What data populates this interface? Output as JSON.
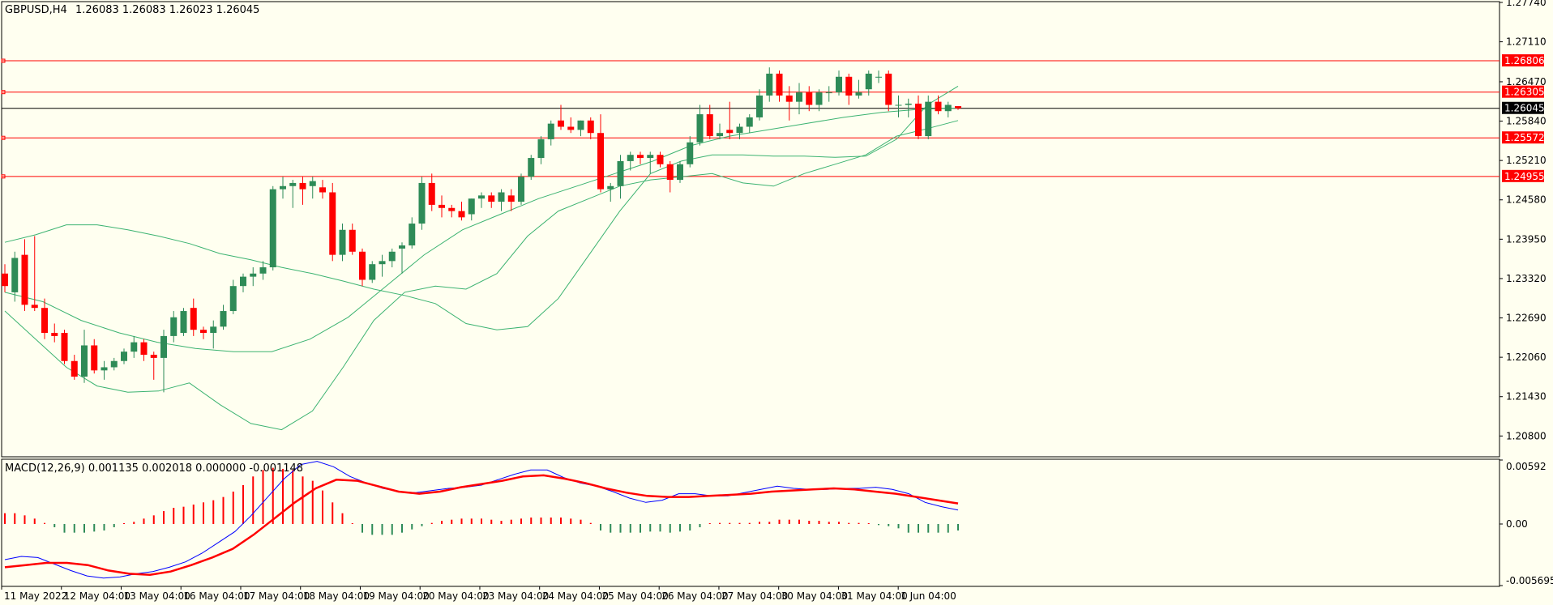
{
  "header": {
    "symbol": "GBPUSD,H4",
    "ohlc": "1.26083 1.26083 1.26023 1.26045"
  },
  "macd": {
    "label": "MACD(12,26,9) 0.001135 0.002018 0.000000 -0.001148"
  },
  "colors": {
    "background": "#fffff0",
    "bull_candle": "#2e8b57",
    "bear_candle": "#ff0000",
    "bands": "#3cb371",
    "hline": "#ff0000",
    "price_tag": "#ff0000",
    "current_price_tag": "#000000",
    "macd_line": "#0000ff",
    "signal_line": "#ff0000"
  },
  "chart_data": [
    {
      "type": "candlestick",
      "name": "GBPUSD H4",
      "ylim": [
        1.2048,
        1.2774
      ],
      "y_ticks": [
        "1.27740",
        "1.27110",
        "1.26470",
        "1.25840",
        "1.25210",
        "1.24580",
        "1.23950",
        "1.23320",
        "1.22690",
        "1.22060",
        "1.21430",
        "1.20800"
      ],
      "x_ticks": [
        "11 May 2022",
        "12 May 04:00",
        "13 May 04:00",
        "16 May 04:00",
        "17 May 04:00",
        "18 May 04:00",
        "19 May 04:00",
        "20 May 04:00",
        "23 May 04:00",
        "24 May 04:00",
        "25 May 04:00",
        "26 May 04:00",
        "27 May 04:00",
        "30 May 04:00",
        "31 May 04:00",
        "1 Jun 04:00"
      ],
      "horizontal_levels": [
        "1.26806",
        "1.26305",
        "1.25572",
        "1.24955"
      ],
      "current_price": "1.26045",
      "candles": [
        [
          1.234,
          1.2355,
          1.231,
          1.232
        ],
        [
          1.231,
          1.2375,
          1.2295,
          1.2365
        ],
        [
          1.237,
          1.2395,
          1.228,
          1.229
        ],
        [
          1.229,
          1.24,
          1.228,
          1.2285
        ],
        [
          1.2285,
          1.23,
          1.2235,
          1.2245
        ],
        [
          1.2245,
          1.226,
          1.223,
          1.224
        ],
        [
          1.2245,
          1.225,
          1.2195,
          1.22
        ],
        [
          1.22,
          1.221,
          1.217,
          1.2175
        ],
        [
          1.2175,
          1.225,
          1.2165,
          1.2225
        ],
        [
          1.2225,
          1.2235,
          1.218,
          1.2185
        ],
        [
          1.2185,
          1.22,
          1.217,
          1.219
        ],
        [
          1.219,
          1.2205,
          1.2185,
          1.22
        ],
        [
          1.22,
          1.222,
          1.2195,
          1.2215
        ],
        [
          1.2215,
          1.224,
          1.2205,
          1.223
        ],
        [
          1.223,
          1.2235,
          1.22,
          1.221
        ],
        [
          1.221,
          1.2215,
          1.217,
          1.2205
        ],
        [
          1.2205,
          1.225,
          1.215,
          1.224
        ],
        [
          1.224,
          1.228,
          1.223,
          1.227
        ],
        [
          1.2245,
          1.2285,
          1.224,
          1.228
        ],
        [
          1.2285,
          1.23,
          1.224,
          1.225
        ],
        [
          1.225,
          1.2255,
          1.2235,
          1.2245
        ],
        [
          1.2245,
          1.2265,
          1.222,
          1.2255
        ],
        [
          1.2255,
          1.229,
          1.225,
          1.228
        ],
        [
          1.228,
          1.233,
          1.2275,
          1.232
        ],
        [
          1.232,
          1.234,
          1.231,
          1.2335
        ],
        [
          1.2335,
          1.235,
          1.232,
          1.234
        ],
        [
          1.234,
          1.236,
          1.233,
          1.235
        ],
        [
          1.235,
          1.248,
          1.2345,
          1.2475
        ],
        [
          1.2475,
          1.2495,
          1.246,
          1.248
        ],
        [
          1.248,
          1.249,
          1.2445,
          1.2485
        ],
        [
          1.2485,
          1.2495,
          1.245,
          1.2475
        ],
        [
          1.248,
          1.2495,
          1.246,
          1.2488
        ],
        [
          1.2478,
          1.249,
          1.246,
          1.247
        ],
        [
          1.247,
          1.2485,
          1.236,
          1.237
        ],
        [
          1.237,
          1.242,
          1.236,
          1.241
        ],
        [
          1.241,
          1.242,
          1.237,
          1.2375
        ],
        [
          1.2375,
          1.238,
          1.232,
          1.233
        ],
        [
          1.233,
          1.236,
          1.2325,
          1.2355
        ],
        [
          1.2355,
          1.237,
          1.2335,
          1.236
        ],
        [
          1.236,
          1.238,
          1.235,
          1.2375
        ],
        [
          1.238,
          1.239,
          1.234,
          1.2385
        ],
        [
          1.2385,
          1.243,
          1.238,
          1.242
        ],
        [
          1.242,
          1.2495,
          1.241,
          1.2485
        ],
        [
          1.2485,
          1.25,
          1.244,
          1.245
        ],
        [
          1.245,
          1.2465,
          1.243,
          1.2445
        ],
        [
          1.2445,
          1.245,
          1.243,
          1.244
        ],
        [
          1.244,
          1.2455,
          1.2425,
          1.243
        ],
        [
          1.2435,
          1.246,
          1.2425,
          1.246
        ],
        [
          1.246,
          1.247,
          1.2445,
          1.2465
        ],
        [
          1.2465,
          1.247,
          1.2445,
          1.2455
        ],
        [
          1.2455,
          1.2475,
          1.244,
          1.247
        ],
        [
          1.2465,
          1.2475,
          1.244,
          1.2455
        ],
        [
          1.2455,
          1.25,
          1.245,
          1.2495
        ],
        [
          1.2495,
          1.253,
          1.249,
          1.2525
        ],
        [
          1.2525,
          1.256,
          1.2515,
          1.2555
        ],
        [
          1.2555,
          1.2585,
          1.2545,
          1.258
        ],
        [
          1.2585,
          1.261,
          1.257,
          1.2575
        ],
        [
          1.2575,
          1.259,
          1.2565,
          1.257
        ],
        [
          1.257,
          1.2585,
          1.256,
          1.2585
        ],
        [
          1.2585,
          1.259,
          1.2555,
          1.2565
        ],
        [
          1.2565,
          1.2595,
          1.247,
          1.2475
        ],
        [
          1.2475,
          1.2485,
          1.2455,
          1.248
        ],
        [
          1.248,
          1.253,
          1.246,
          1.252
        ],
        [
          1.252,
          1.2535,
          1.2505,
          1.253
        ],
        [
          1.253,
          1.2535,
          1.2515,
          1.2525
        ],
        [
          1.2525,
          1.2535,
          1.25,
          1.253
        ],
        [
          1.253,
          1.2535,
          1.251,
          1.2515
        ],
        [
          1.2515,
          1.252,
          1.247,
          1.249
        ],
        [
          1.249,
          1.252,
          1.2485,
          1.2515
        ],
        [
          1.2515,
          1.256,
          1.251,
          1.255
        ],
        [
          1.255,
          1.261,
          1.2545,
          1.2595
        ],
        [
          1.2595,
          1.261,
          1.2555,
          1.256
        ],
        [
          1.256,
          1.258,
          1.2555,
          1.2565
        ],
        [
          1.257,
          1.2615,
          1.2555,
          1.2565
        ],
        [
          1.2565,
          1.258,
          1.2555,
          1.2575
        ],
        [
          1.2575,
          1.2595,
          1.2565,
          1.259
        ],
        [
          1.259,
          1.2635,
          1.2585,
          1.2625
        ],
        [
          1.2625,
          1.267,
          1.2615,
          1.266
        ],
        [
          1.266,
          1.2665,
          1.2615,
          1.2625
        ],
        [
          1.2625,
          1.264,
          1.2585,
          1.2615
        ],
        [
          1.2615,
          1.2645,
          1.2595,
          1.263
        ],
        [
          1.263,
          1.264,
          1.26,
          1.261
        ],
        [
          1.261,
          1.2635,
          1.26,
          1.263
        ],
        [
          1.263,
          1.264,
          1.2615,
          1.263
        ],
        [
          1.263,
          1.2665,
          1.2625,
          1.2655
        ],
        [
          1.2655,
          1.266,
          1.261,
          1.2625
        ],
        [
          1.2625,
          1.265,
          1.262,
          1.263
        ],
        [
          1.2635,
          1.2665,
          1.2625,
          1.266
        ],
        [
          1.2655,
          1.2665,
          1.2645,
          1.2655
        ],
        [
          1.266,
          1.2665,
          1.26,
          1.261
        ],
        [
          1.261,
          1.2625,
          1.259,
          1.261
        ],
        [
          1.261,
          1.262,
          1.259,
          1.2612
        ],
        [
          1.2612,
          1.2625,
          1.2555,
          1.256
        ],
        [
          1.256,
          1.2625,
          1.2555,
          1.2615
        ],
        [
          1.2615,
          1.2625,
          1.2595,
          1.26
        ],
        [
          1.26,
          1.2615,
          1.259,
          1.261
        ],
        [
          1.2608,
          1.2608,
          1.2602,
          1.26045
        ]
      ],
      "bollinger_upper": [
        1.239,
        1.2402,
        1.2418,
        1.2418,
        1.241,
        1.24,
        1.2388,
        1.2372,
        1.2362,
        1.235,
        1.234,
        1.2328,
        1.2315,
        1.2305,
        1.2292,
        1.226,
        1.225,
        1.2255,
        1.23,
        1.237,
        1.244,
        1.25,
        1.252,
        1.253,
        1.253,
        1.2528,
        1.2528,
        1.2526,
        1.2528,
        1.2555,
        1.261,
        1.264
      ],
      "bollinger_middle": [
        1.231,
        1.2295,
        1.2265,
        1.2245,
        1.223,
        1.222,
        1.2215,
        1.2215,
        1.2235,
        1.227,
        1.232,
        1.237,
        1.241,
        1.2435,
        1.246,
        1.248,
        1.25,
        1.252,
        1.2545,
        1.256,
        1.257,
        1.258,
        1.259,
        1.2598,
        1.2603,
        1.2605
      ],
      "bollinger_lower": [
        1.228,
        1.2235,
        1.219,
        1.216,
        1.215,
        1.2152,
        1.2165,
        1.213,
        1.21,
        1.209,
        1.212,
        1.219,
        1.2265,
        1.231,
        1.232,
        1.2315,
        1.234,
        1.24,
        1.244,
        1.246,
        1.248,
        1.249,
        1.2495,
        1.25,
        1.2485,
        1.248,
        1.25,
        1.2515,
        1.253,
        1.256,
        1.2572,
        1.2585
      ]
    },
    {
      "type": "macd",
      "name": "MACD(12,26,9)",
      "ylim": [
        -0.005695,
        0.00592
      ],
      "y_ticks": [
        "0.00592",
        "0.00",
        "-0.005695"
      ],
      "histogram": [
        0.001,
        0.001,
        0.0008,
        0.0005,
        0.0001,
        -0.0003,
        -0.0008,
        -0.0008,
        -0.0008,
        -0.0007,
        -0.0006,
        -0.0003,
        0.0,
        0.0002,
        0.0005,
        0.0008,
        0.0012,
        0.0015,
        0.0016,
        0.0018,
        0.002,
        0.0022,
        0.0025,
        0.003,
        0.0036,
        0.0044,
        0.005,
        0.0052,
        0.0051,
        0.005,
        0.0044,
        0.004,
        0.0031,
        0.002,
        0.001,
        0.0,
        -0.0008,
        -0.001,
        -0.001,
        -0.001,
        -0.0008,
        -0.0005,
        -0.0002,
        0.0001,
        0.0003,
        0.0004,
        0.0005,
        0.0005,
        0.0005,
        0.0004,
        0.0003,
        0.0004,
        0.0005,
        0.0006,
        0.0006,
        0.0006,
        0.0006,
        0.0005,
        0.0004,
        0.0001,
        -0.0006,
        -0.0008,
        -0.0008,
        -0.0008,
        -0.0008,
        -0.0007,
        -0.0007,
        -0.0008,
        -0.0007,
        -0.0006,
        -0.0003,
        0.0,
        0.0001,
        0.0001,
        0.0001,
        0.0001,
        0.0002,
        0.0002,
        0.0004,
        0.0004,
        0.0004,
        0.0003,
        0.0003,
        0.0002,
        0.0002,
        0.0001,
        0.0001,
        0.0,
        -0.0001,
        -0.0002,
        -0.0004,
        -0.0008,
        -0.0008,
        -0.0008,
        -0.0008,
        -0.0008,
        -0.0006
      ],
      "macd_line": [
        -0.0033,
        -0.003,
        -0.0031,
        -0.0037,
        -0.0043,
        -0.0048,
        -0.005,
        -0.0049,
        -0.0046,
        -0.0044,
        -0.004,
        -0.0035,
        -0.0027,
        -0.0017,
        -0.0007,
        0.0008,
        0.0025,
        0.0042,
        0.0055,
        0.0058,
        0.0053,
        0.0044,
        0.0038,
        0.0033,
        0.003,
        0.0029,
        0.0031,
        0.0033,
        0.0034,
        0.0036,
        0.0041,
        0.0046,
        0.005,
        0.005,
        0.0043,
        0.0038,
        0.0035,
        0.003,
        0.0024,
        0.002,
        0.0022,
        0.0028,
        0.0028,
        0.0026,
        0.0026,
        0.0029,
        0.0032,
        0.0035,
        0.0033,
        0.0032,
        0.0032,
        0.0033,
        0.0033,
        0.0034,
        0.0032,
        0.0028,
        0.002,
        0.0016,
        0.0013
      ],
      "signal_line": [
        -0.004,
        -0.0038,
        -0.0036,
        -0.0036,
        -0.0038,
        -0.0043,
        -0.0046,
        -0.0047,
        -0.0044,
        -0.0038,
        -0.0031,
        -0.0023,
        -0.001,
        0.0005,
        0.002,
        0.0033,
        0.0041,
        0.004,
        0.0035,
        0.003,
        0.0028,
        0.003,
        0.0034,
        0.0037,
        0.004,
        0.0044,
        0.0045,
        0.0042,
        0.0038,
        0.0033,
        0.0029,
        0.0026,
        0.0025,
        0.0025,
        0.0026,
        0.0027,
        0.0028,
        0.003,
        0.0031,
        0.0032,
        0.0033,
        0.0032,
        0.003,
        0.0028,
        0.0025,
        0.0022,
        0.0019
      ]
    }
  ]
}
